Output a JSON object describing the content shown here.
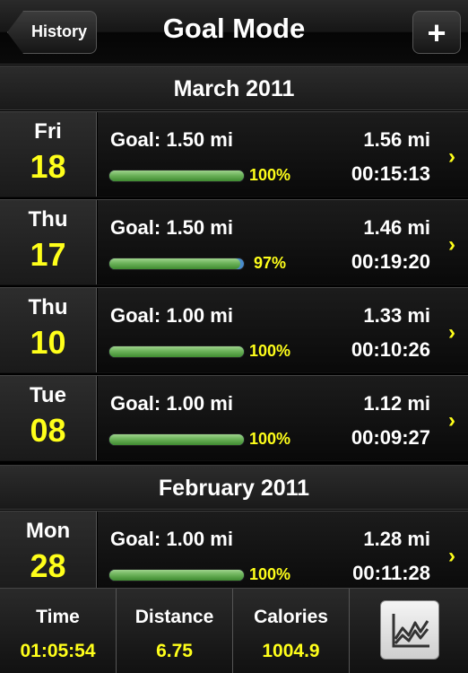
{
  "navbar": {
    "title": "Goal Mode",
    "back_label": "History",
    "add_label": "+"
  },
  "sections": [
    {
      "title": "March 2011",
      "rows": [
        {
          "dow": "Fri",
          "day": "18",
          "goal": "Goal: 1.50 mi",
          "distance": "1.56 mi",
          "duration": "00:15:13",
          "percent_label": "100%",
          "progress": 1.0
        },
        {
          "dow": "Thu",
          "day": "17",
          "goal": "Goal: 1.50 mi",
          "distance": "1.46 mi",
          "duration": "00:19:20",
          "percent_label": "97%",
          "progress": 0.97
        },
        {
          "dow": "Thu",
          "day": "10",
          "goal": "Goal: 1.00 mi",
          "distance": "1.33 mi",
          "duration": "00:10:26",
          "percent_label": "100%",
          "progress": 1.0
        },
        {
          "dow": "Tue",
          "day": "08",
          "goal": "Goal: 1.00 mi",
          "distance": "1.12 mi",
          "duration": "00:09:27",
          "percent_label": "100%",
          "progress": 1.0
        }
      ]
    },
    {
      "title": "February 2011",
      "rows": [
        {
          "dow": "Mon",
          "day": "28",
          "goal": "Goal: 1.00 mi",
          "distance": "1.28 mi",
          "duration": "00:11:28",
          "percent_label": "100%",
          "progress": 1.0
        }
      ]
    }
  ],
  "chevron": "›",
  "footer": {
    "time_label": "Time",
    "time_value": "01:05:54",
    "distance_label": "Distance",
    "distance_value": "6.75",
    "calories_label": "Calories",
    "calories_value": "1004.9",
    "chart_icon": "line-chart-icon"
  },
  "colors": {
    "accent": "#ffff1a",
    "progress": "#6cb35a",
    "background": "#000000"
  }
}
